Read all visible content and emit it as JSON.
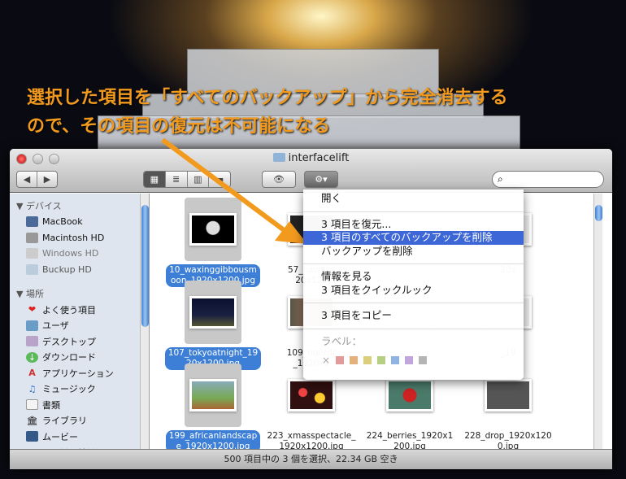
{
  "annotation": {
    "line1": "選択した項目を「すべてのバックアップ」から完全消去する",
    "line2": "ので、その項目の復元は不可能になる"
  },
  "window": {
    "title": "interfacelift"
  },
  "toolbar": {
    "back": "◀",
    "forward": "▶",
    "views": [
      "▦",
      "≣",
      "▥",
      "▬"
    ],
    "eye": "👁",
    "action": "⚙▾",
    "search_placeholder": ""
  },
  "sidebar": {
    "devices_header": "▼ デバイス",
    "devices": [
      "MacBook",
      "Macintosh HD",
      "Windows HD",
      "Buckup HD"
    ],
    "places_header": "▼ 場所",
    "places": [
      "よく使う項目",
      "ユーザ",
      "デスクトップ",
      "ダウンロード",
      "アプリケーション",
      "ミュージック",
      "書類",
      "ライブラリ",
      "ムービー",
      "ユーティリティ"
    ]
  },
  "files": [
    {
      "name": "10_waxinggibbousmoon_1920x1200.jpg",
      "l1": "10_waxinggibbousm",
      "l2": "oon_1920x1200.jpg",
      "selected": true
    },
    {
      "name": "57_hawaiis...",
      "l1": "57_hawaiis",
      "l2": "20x120",
      "selected": false
    },
    {
      "name": "",
      "l1": "",
      "l2": "",
      "selected": false
    },
    {
      "name": "...20x",
      "l1": "20x",
      "l2": "",
      "selected": false
    },
    {
      "name": "107_tokyoatnight_1920x1200.jpg",
      "l1": "107_tokyoatnight_19",
      "l2": "20x1200.jpg",
      "selected": true
    },
    {
      "name": "109_tigerdr...",
      "l1": "109_tigerdr",
      "l2": "_1920x1",
      "selected": false
    },
    {
      "name": "",
      "l1": "",
      "l2": "",
      "selected": false
    },
    {
      "name": "..._19",
      "l1": "_19",
      "l2": "",
      "selected": false
    },
    {
      "name": "199_africanlandscape_1920x1200.jpg",
      "l1": "199_africanlandscap",
      "l2": "e_1920x1200.jpg",
      "selected": true
    },
    {
      "name": "223_xmasspectacle_1920x1200.jpg",
      "l1": "223_xmasspectacle_",
      "l2": "1920x1200.jpg",
      "selected": false
    },
    {
      "name": "224_berries_1920x1200.jpg",
      "l1": "224_berries_1920x1",
      "l2": "200.jpg",
      "selected": false
    },
    {
      "name": "228_drop_1920x1200.jpg",
      "l1": "228_drop_1920x120",
      "l2": "0.jpg",
      "selected": false
    }
  ],
  "menu": {
    "open": "開く",
    "restore": "3 項目を復元...",
    "delete_all_backups": "3 項目のすべてのバックアップを削除",
    "delete_backup": "バックアップを削除",
    "get_info": "情報を見る",
    "quicklook": "3 項目をクイックルック",
    "copy": "3 項目をコピー",
    "label": "ラベル：",
    "label_none": "×",
    "label_colors": [
      "#e39a9a",
      "#e3b07e",
      "#dccf7c",
      "#b6cf83",
      "#8fb4e3",
      "#c1a5db",
      "#b5b5b5"
    ]
  },
  "status": "500 項目中の 3 個を選択、22.34 GB 空き"
}
